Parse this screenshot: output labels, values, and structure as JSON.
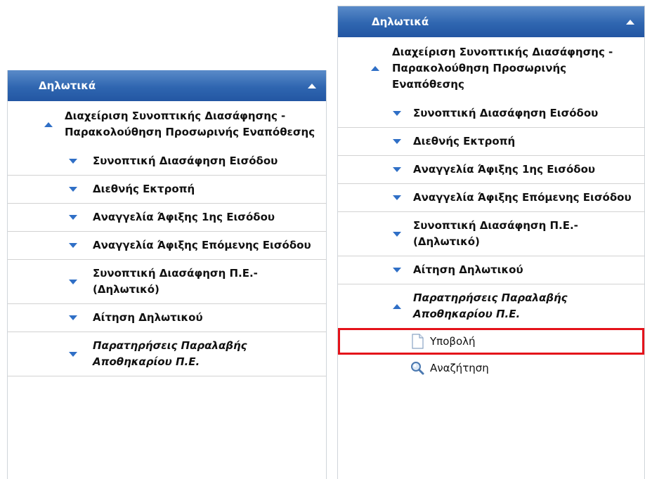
{
  "colors": {
    "header_bg": "#2f66b0",
    "arrow": "#2f6fc6",
    "highlight": "#e4121a"
  },
  "left_panel": {
    "header": "Δηλωτικά",
    "items": [
      {
        "label": "Διαχείριση Συνοπτικής Διασάφησης - Παρακολούθηση Προσωρινής Εναπόθεσης",
        "state": "expanded"
      },
      {
        "label": "Συνοπτική Διασάφηση Εισόδου",
        "state": "collapsed"
      },
      {
        "label": "Διεθνής Εκτροπή",
        "state": "collapsed"
      },
      {
        "label": "Αναγγελία Άφιξης 1ης Εισόδου",
        "state": "collapsed"
      },
      {
        "label": "Αναγγελία Άφιξης Επόμενης Εισόδου",
        "state": "collapsed"
      },
      {
        "label": "Συνοπτική Διασάφηση Π.Ε.- (Δηλωτικό)",
        "state": "collapsed"
      },
      {
        "label": "Αίτηση Δηλωτικού",
        "state": "collapsed"
      },
      {
        "label": "Παρατηρήσεις Παραλαβής Αποθηκαρίου Π.Ε.",
        "state": "collapsed"
      }
    ]
  },
  "right_panel": {
    "header": "Δηλωτικά",
    "items": [
      {
        "label": "Διαχείριση Συνοπτικής Διασάφησης - Παρακολούθηση Προσωρινής Εναπόθεσης",
        "state": "expanded"
      },
      {
        "label": "Συνοπτική Διασάφηση Εισόδου",
        "state": "collapsed"
      },
      {
        "label": "Διεθνής Εκτροπή",
        "state": "collapsed"
      },
      {
        "label": "Αναγγελία Άφιξης 1ης Εισόδου",
        "state": "collapsed"
      },
      {
        "label": "Αναγγελία Άφιξης Επόμενης Εισόδου",
        "state": "collapsed"
      },
      {
        "label": "Συνοπτική Διασάφηση Π.Ε.- (Δηλωτικό)",
        "state": "collapsed"
      },
      {
        "label": "Αίτηση Δηλωτικού",
        "state": "collapsed"
      },
      {
        "label": "Παρατηρήσεις Παραλαβής Αποθηκαρίου Π.Ε.",
        "state": "expanded"
      }
    ],
    "subitems": [
      {
        "label": "Υποβολή",
        "icon": "document-icon",
        "highlighted": true
      },
      {
        "label": "Αναζήτηση",
        "icon": "magnifier-icon",
        "highlighted": false
      }
    ]
  }
}
